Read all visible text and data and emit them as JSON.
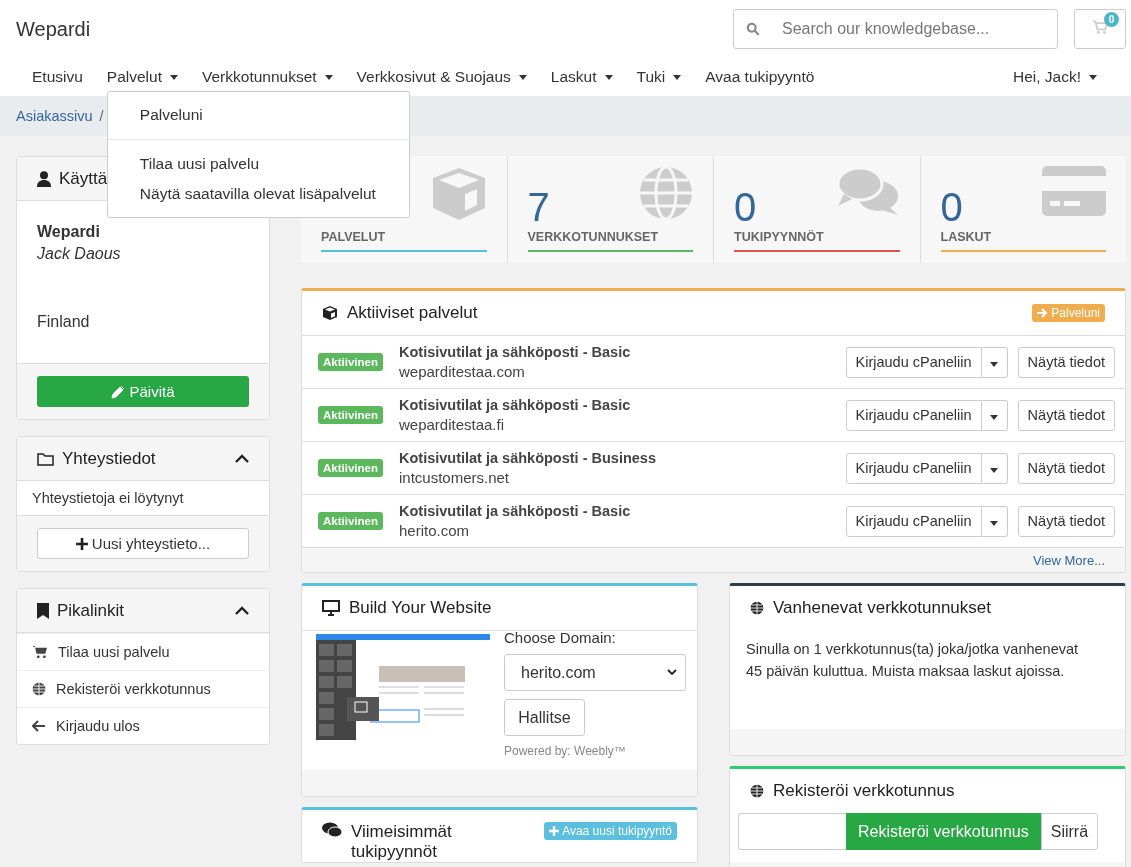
{
  "header": {
    "brand": "Wepardi",
    "search": {
      "placeholder": "Search our knowledgebase..."
    },
    "cart_count": "0"
  },
  "nav": {
    "items": [
      {
        "label": "Etusivu",
        "dropdown": false,
        "expanded": false
      },
      {
        "label": "Palvelut",
        "dropdown": true,
        "expanded": true
      },
      {
        "label": "Verkkotunnukset",
        "dropdown": true,
        "expanded": false
      },
      {
        "label": "Verkkosivut & Suojaus",
        "dropdown": true,
        "expanded": false
      },
      {
        "label": "Laskut",
        "dropdown": true,
        "expanded": false
      },
      {
        "label": "Tuki",
        "dropdown": true,
        "expanded": false
      },
      {
        "label": "Avaa tukipyyntö",
        "dropdown": false,
        "expanded": false
      }
    ],
    "account": {
      "label": "Hei, Jack!"
    }
  },
  "breadcrumb": {
    "items": [
      "Asiakassivu"
    ],
    "separator": "/"
  },
  "nav_dropdown": {
    "groups": [
      [
        "Palveluni"
      ],
      [
        "Tilaa uusi palvelu",
        "Näytä saatavilla olevat lisäpalvelut"
      ]
    ]
  },
  "profile": {
    "title": "Käyttä",
    "company": "Wepardi",
    "name": "Jack Daous",
    "country": "Finland",
    "button": "Päivitä"
  },
  "contacts": {
    "title": "Yhteystiedot",
    "expanded": true,
    "empty": "Yhteystietoja ei löytynyt",
    "button": "Uusi yhteystieto..."
  },
  "quick_links": {
    "title": "Pikalinkit",
    "expanded": true,
    "items": [
      "Tilaa uusi palvelu",
      "Rekisteröi verkkotunnus",
      "Kirjaudu ulos"
    ]
  },
  "stats": [
    {
      "label": "PALVELUT",
      "color": "#5bc0de"
    },
    {
      "value": "7",
      "label": "VERKKOTUNNUKSET",
      "color": "#5cb85c"
    },
    {
      "value": "0",
      "label": "TUKIPYYNNÖT",
      "color": "#d9534f"
    },
    {
      "value": "0",
      "label": "LASKUT",
      "color": "#f0ad4e"
    }
  ],
  "active_services": {
    "title": "Aktiiviset palvelut",
    "link": "Palveluni",
    "rows": [
      {
        "status": "Aktiivinen",
        "product": "Kotisivutilat ja sähköposti - Basic",
        "domain": "weparditestaa.com",
        "login_button": "Kirjaudu cPaneliin",
        "details_button": "Näytä tiedot"
      },
      {
        "status": "Aktiivinen",
        "product": "Kotisivutilat ja sähköposti - Basic",
        "domain": "weparditestaa.fi",
        "login_button": "Kirjaudu cPaneliin",
        "details_button": "Näytä tiedot"
      },
      {
        "status": "Aktiivinen",
        "product": "Kotisivutilat ja sähköposti - Business",
        "domain": "intcustomers.net",
        "login_button": "Kirjaudu cPaneliin",
        "details_button": "Näytä tiedot"
      },
      {
        "status": "Aktiivinen",
        "product": "Kotisivutilat ja sähköposti - Basic",
        "domain": "herito.com",
        "login_button": "Kirjaudu cPaneliin",
        "details_button": "Näytä tiedot"
      }
    ],
    "footer_link": "View More..."
  },
  "website_builder": {
    "title": "Build Your Website",
    "domain_label": "Choose Domain:",
    "domain": "herito.com",
    "button": "Hallitse",
    "powered_by": "Powered by: Weebly™"
  },
  "expiring": {
    "title": "Vanhenevat verkkotunnukset",
    "text": "Sinulla on 1 verkkotunnus(ta) joka/jotka vanhenevat 45 päivän kuluttua. Muista maksaa laskut ajoissa."
  },
  "register": {
    "title": "Rekisteröi verkkotunnus",
    "button": "Rekisteröi verkkotunnus",
    "transfer_button": "Siirrä"
  },
  "tickets": {
    "title": "Viimeisimmät tukipyynnöt",
    "button": "Avaa uusi tukipyyntö"
  }
}
